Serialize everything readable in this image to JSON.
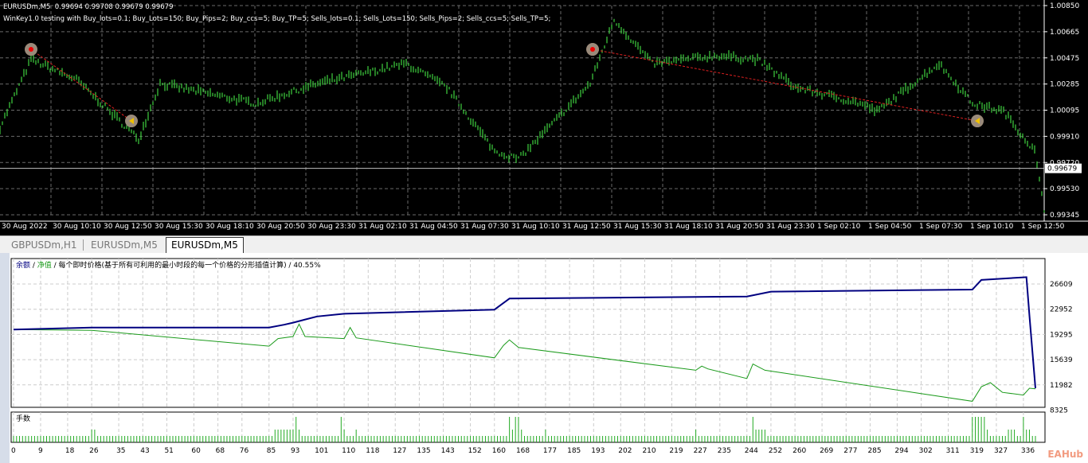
{
  "header": {
    "symbol_line": "EURUSDm,M5  0.99694 0.99708 0.99679 0.99679",
    "ea_line": "WinKey1.0 testing with Buy_lots=0.1; Buy_Lots=150; Buy_Pips=2; Buy_ccs=5; Buy_TP=5; Sells_lots=0.1; Sells_Lots=150; Sells_Pips=2; Sells_ccs=5; Sells_TP=5;"
  },
  "tabs": [
    {
      "label": "GBPUSDm,H1",
      "active": false
    },
    {
      "label": "EURUSDm,M5",
      "active": false
    },
    {
      "label": "EURUSDm,M5",
      "active": true
    }
  ],
  "tester": {
    "legend_balance": "余额",
    "legend_sep1": " / ",
    "legend_equity": "净值",
    "legend_rest": " / 每个即时价格(基于所有可利用的最小时段的每一个价格的分形插值计算) / 40.55%",
    "volume_label": "手数"
  },
  "watermark": "EAHub",
  "colors": {
    "bars": "#3fd23f",
    "balance": "#000080",
    "equity": "#1a9a1a",
    "volume": "#22aa22",
    "trade_line": "#e02020"
  },
  "chart_data": [
    {
      "type": "line",
      "title": "EURUSDm,M5",
      "current_price": "0.99679",
      "ylim": [
        0.99345,
        1.0085
      ],
      "yticks": [
        "1.00850",
        "1.00665",
        "1.00475",
        "1.00285",
        "1.00095",
        "0.99910",
        "0.99720",
        "0.99530",
        "0.99345"
      ],
      "xticks": [
        "30 Aug 2022",
        "30 Aug 10:10",
        "30 Aug 12:50",
        "30 Aug 15:30",
        "30 Aug 18:10",
        "30 Aug 20:50",
        "30 Aug 23:30",
        "31 Aug 02:10",
        "31 Aug 04:50",
        "31 Aug 07:30",
        "31 Aug 10:10",
        "31 Aug 12:50",
        "31 Aug 15:30",
        "31 Aug 18:10",
        "31 Aug 20:50",
        "31 Aug 23:30",
        "1 Sep 02:10",
        "1 Sep 04:50",
        "1 Sep 07:30",
        "1 Sep 10:10",
        "1 Sep 12:50"
      ],
      "bars_total": 437,
      "price_path": [
        [
          0,
          0.99975
        ],
        [
          13,
          1.00461
        ],
        [
          32,
          1.00318
        ],
        [
          58,
          0.99889
        ],
        [
          67,
          1.00289
        ],
        [
          107,
          1.00146
        ],
        [
          133,
          1.00289
        ],
        [
          170,
          1.00432
        ],
        [
          187,
          1.00261
        ],
        [
          207,
          0.99803
        ],
        [
          217,
          0.99746
        ],
        [
          233,
          1.00032
        ],
        [
          247,
          1.00289
        ],
        [
          257,
          1.00747
        ],
        [
          273,
          1.00432
        ],
        [
          300,
          1.0049
        ],
        [
          317,
          1.00461
        ],
        [
          333,
          1.00261
        ],
        [
          360,
          1.00146
        ],
        [
          367,
          1.00089
        ],
        [
          393,
          1.00432
        ],
        [
          407,
          1.00146
        ],
        [
          420,
          1.00089
        ],
        [
          433,
          0.99803
        ],
        [
          437,
          0.99374
        ]
      ],
      "trades": [
        {
          "open_bar": 13,
          "open_price": 1.00535,
          "close_bar": 55,
          "close_price": 1.0002
        },
        {
          "open_bar": 248,
          "open_price": 1.00535,
          "close_bar": 409,
          "close_price": 1.0002
        }
      ]
    },
    {
      "type": "line",
      "title": "Balance / Equity",
      "ylim": [
        8325,
        28000
      ],
      "yticks": [
        "26609",
        "22952",
        "19295",
        "15639",
        "11982",
        "8325"
      ],
      "xticks": [
        "0",
        "9",
        "18",
        "26",
        "35",
        "43",
        "51",
        "60",
        "68",
        "76",
        "85",
        "93",
        "101",
        "110",
        "118",
        "127",
        "135",
        "143",
        "152",
        "160",
        "168",
        "177",
        "185",
        "193",
        "202",
        "210",
        "219",
        "227",
        "235",
        "244",
        "252",
        "260",
        "269",
        "277",
        "285",
        "294",
        "302",
        "311",
        "319",
        "327",
        "336"
      ],
      "xlim": [
        0,
        340
      ],
      "series": [
        {
          "name": "余额",
          "values": [
            [
              0,
              20000
            ],
            [
              26,
              20300
            ],
            [
              85,
              20300
            ],
            [
              90,
              20700
            ],
            [
              93,
              21000
            ],
            [
              101,
              21900
            ],
            [
              110,
              22300
            ],
            [
              160,
              22900
            ],
            [
              165,
              24500
            ],
            [
              244,
              24800
            ],
            [
              252,
              25500
            ],
            [
              319,
              25800
            ],
            [
              322,
              27200
            ],
            [
              337,
              27600
            ],
            [
              338,
              22000
            ],
            [
              340,
              11500
            ]
          ]
        },
        {
          "name": "净值",
          "values": [
            [
              0,
              20000
            ],
            [
              26,
              19900
            ],
            [
              85,
              17600
            ],
            [
              88,
              18700
            ],
            [
              93,
              19000
            ],
            [
              95,
              20800
            ],
            [
              97,
              19000
            ],
            [
              110,
              18700
            ],
            [
              112,
              20300
            ],
            [
              114,
              18800
            ],
            [
              160,
              15900
            ],
            [
              163,
              17700
            ],
            [
              165,
              18500
            ],
            [
              168,
              17400
            ],
            [
              227,
              14100
            ],
            [
              229,
              14700
            ],
            [
              231,
              14300
            ],
            [
              244,
              12900
            ],
            [
              246,
              15000
            ],
            [
              250,
              14100
            ],
            [
              319,
              9600
            ],
            [
              322,
              11700
            ],
            [
              325,
              12300
            ],
            [
              329,
              10900
            ],
            [
              336,
              10500
            ],
            [
              338,
              11500
            ],
            [
              340,
              11400
            ]
          ]
        }
      ]
    },
    {
      "type": "bar",
      "title": "手数",
      "count": 341,
      "default_level": 1,
      "level2": [
        26,
        27,
        87,
        88,
        89,
        90,
        91,
        92,
        93,
        95,
        110,
        114,
        166,
        169,
        177,
        227,
        247,
        248,
        249,
        250,
        324,
        331,
        332,
        333,
        337,
        338
      ],
      "level4": [
        94,
        109,
        165,
        167,
        168,
        246,
        319,
        320,
        321,
        322,
        323,
        336
      ]
    }
  ]
}
